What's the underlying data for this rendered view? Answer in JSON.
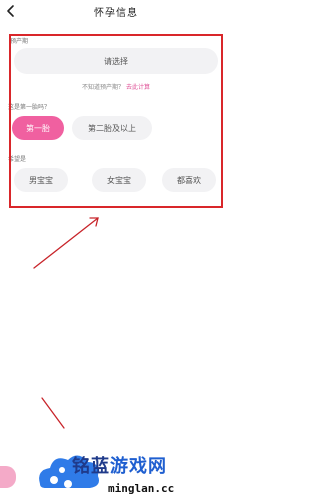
{
  "header": {
    "title": "怀孕信息"
  },
  "due_date": {
    "label": "预产期",
    "placeholder": "请选择",
    "hint_prefix": "不知道预产期？",
    "hint_link": "去此计算"
  },
  "first_baby": {
    "label": "这是第一胎吗？",
    "options": [
      "第一胎",
      "第二胎及以上"
    ],
    "selected": 0
  },
  "expectation": {
    "label": "希望是",
    "options": [
      "男宝宝",
      "女宝宝",
      "都喜欢"
    ]
  },
  "watermark": {
    "brand": "铭蓝",
    "brand2": "游戏网",
    "url": "minglan.cc"
  },
  "colors": {
    "accent": "#f060a0",
    "highlight": "#d9262a",
    "pill_bg": "#f2f2f4"
  },
  "icons": {
    "back": "chevron-left-icon"
  }
}
